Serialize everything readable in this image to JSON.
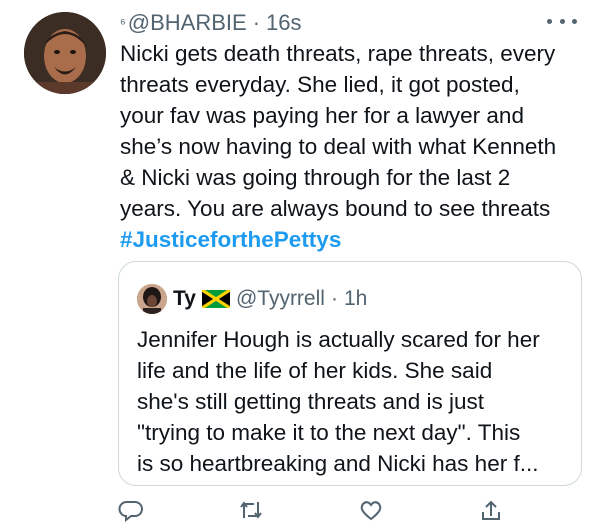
{
  "tweet": {
    "author_mark": "⁶",
    "handle": "@BHARBIE",
    "dot": "·",
    "time": "16s",
    "more_icon": "more-horizontal-icon",
    "lines": [
      "Nicki gets death threats, rape threats, every",
      "threats everyday. She lied, it got posted,",
      "your fav was paying her for a lawyer and",
      "she’s now having to deal with what Kenneth",
      "& Nicki was going through for the last 2",
      "years. You are always bound to see threats"
    ],
    "hashtag": "#JusticeforthePettys"
  },
  "quoted_tweet": {
    "name": "Ty",
    "flag_icon": "jamaica-flag-icon",
    "handle": "@Tyyrrell",
    "dot": "·",
    "time": "1h",
    "lines": [
      "Jennifer Hough is actually scared for her",
      "life and the life of her kids. She said",
      "she's still getting threats and is just",
      "\"trying to make it to the next day\". This",
      "is so heartbreaking and Nicki has her f..."
    ]
  },
  "actions": [
    "reply-icon",
    "retweet-icon",
    "like-icon",
    "share-icon"
  ],
  "colors": {
    "text": "#0f1419",
    "secondary": "#536471",
    "link": "#1d9bf0",
    "border": "#cfd9de"
  }
}
